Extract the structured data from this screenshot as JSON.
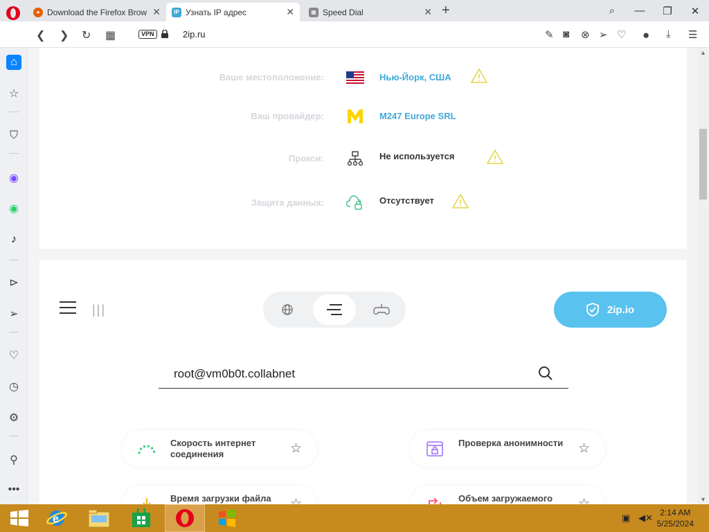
{
  "browser": {
    "tabs": [
      {
        "title": "Download the Firefox Brow",
        "favicon": "firefox-icon",
        "active": false
      },
      {
        "title": "Узнать IP адрес",
        "favicon": "ip-icon",
        "active": true
      },
      {
        "title": "Speed Dial",
        "favicon": "speed-dial-icon",
        "active": false
      }
    ],
    "vpn_label": "VPN",
    "url": "2ip.ru"
  },
  "info": {
    "rows": [
      {
        "label": "Ваше местоположение:",
        "value": "Нью-Йорк, США",
        "icon": "us-flag-icon",
        "warning": true
      },
      {
        "label": "Ваш провайдер:",
        "value": "M247 Europe SRL",
        "icon": "provider-logo-icon",
        "warning": false
      },
      {
        "label": "Прокси:",
        "value": "Не используется",
        "icon": "network-icon",
        "warning": true
      },
      {
        "label": "Защита данных:",
        "value": "Отсутствует",
        "icon": "cloud-lock-icon",
        "warning": true
      }
    ]
  },
  "toolbar": {
    "brand_button": "2ip.io"
  },
  "search": {
    "value": "root@vm0b0t.collabnet"
  },
  "services": [
    {
      "label": "Скорость интернет соединения",
      "icon": "speedometer-icon"
    },
    {
      "label": "Проверка анонимности",
      "icon": "anonymity-icon"
    },
    {
      "label": "Время загрузки файла",
      "icon": "download-time-icon"
    },
    {
      "label": "Объем загружаемого",
      "icon": "upload-volume-icon"
    }
  ],
  "clock": {
    "time": "2:14 AM",
    "date": "5/25/2024"
  },
  "colors": {
    "accent": "#59c2ee",
    "link": "#3fa9d8",
    "taskbar": "#c78a1e",
    "warning": "#e8d44d"
  }
}
